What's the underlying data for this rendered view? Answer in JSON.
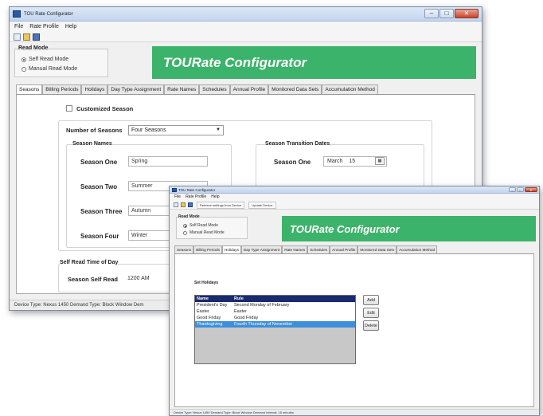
{
  "back_window": {
    "title": "TOU Rate Configurator",
    "menu": [
      "File",
      "Rate Profile",
      "Help"
    ],
    "read_mode": {
      "legend": "Read Mode",
      "options": [
        "Self Read Mode",
        "Manual Read Mode"
      ],
      "selected": 0
    },
    "banner": "TOURate Configurator",
    "tabs": [
      "Seasons",
      "Billing Periods",
      "Holidays",
      "Day Type Assignment",
      "Rate Names",
      "Schedules",
      "Annual Profile",
      "Monitored Data Sets",
      "Accumulation Method"
    ],
    "active_tab": 0,
    "customized_season_label": "Customized Season",
    "number_of_seasons_label": "Number of Seasons",
    "number_of_seasons_value": "Four Seasons",
    "season_names_legend": "Season Names",
    "seasons": [
      {
        "label": "Season One",
        "value": "Spring"
      },
      {
        "label": "Season Two",
        "value": "Summer"
      },
      {
        "label": "Season Three",
        "value": "Autumn"
      },
      {
        "label": "Season Four",
        "value": "Winter"
      }
    ],
    "transition_legend": "Season Transition Dates",
    "transition": {
      "label": "Season One",
      "month": "March",
      "day": "15"
    },
    "self_read_legend": "Self Read Time of Day",
    "self_read_label": "Season Self Read",
    "self_read_value": "1200 AM",
    "status": "Device Type: Nexus 1450   Demand Type: Block Window  Dem"
  },
  "front_window": {
    "title": "TOU Rate Configurator",
    "menu": [
      "File",
      "Rate Profile",
      "Help"
    ],
    "toolbar_buttons": [
      "Retrieve settings from Device",
      "Update Device"
    ],
    "read_mode": {
      "legend": "Read Mode",
      "options": [
        "Self Read Mode",
        "Manual Read Mode"
      ],
      "selected": 0
    },
    "banner": "TOURate Configurator",
    "tabs": [
      "Seasons",
      "Billing Periods",
      "Holidays",
      "Day Type Assignment",
      "Rate Names",
      "Schedules",
      "Annual Profile",
      "Monitored Data Sets",
      "Accumulation Method"
    ],
    "active_tab": 2,
    "set_holidays_label": "Set Holidays",
    "grid_columns": [
      "Name",
      "Rule"
    ],
    "holidays": [
      {
        "name": "President's Day",
        "rule": "Second Monday of February"
      },
      {
        "name": "Easter",
        "rule": "Easter"
      },
      {
        "name": "Good Friday",
        "rule": "Good Friday"
      },
      {
        "name": "Thanksgiving",
        "rule": "Fourth Thursday of November"
      }
    ],
    "selected_row": 3,
    "buttons": [
      "Add",
      "Edit",
      "Delete"
    ],
    "status": "Device Type: Nexus 1450   Demand Type: Block Window  Demand Interval: 15 minutes"
  },
  "colors": {
    "banner": "#3cb36a",
    "grid_header": "#1a2a6e",
    "grid_selection": "#3f8edb"
  }
}
